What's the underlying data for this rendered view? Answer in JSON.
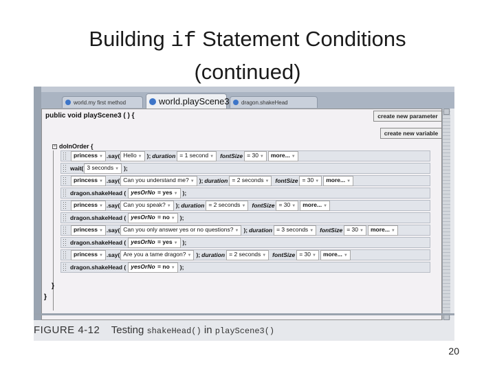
{
  "slide": {
    "title_pre": "Building ",
    "title_code": "if",
    "title_post": " Statement Conditions",
    "title_line2": "(continued)",
    "page_number": "20"
  },
  "tabs": [
    {
      "label": "world.my first method"
    },
    {
      "label": "world.playScene3"
    },
    {
      "label": "dragon.shakeHead"
    }
  ],
  "method": {
    "signature": "public void playScene3 ( ) {",
    "create_param_label": "create new parameter",
    "create_var_label": "create new variable",
    "do_in_order": "doInOrder {",
    "closing_inner": "}",
    "closing_outer": "}"
  },
  "rows": [
    {
      "obj": "princess",
      "call": ".say(",
      "arg": "Hello",
      "close": ");",
      "p1l": "duration",
      "p1v": "= 1 second",
      "p2l": "fontSize",
      "p2v": "= 30",
      "more": "more..."
    },
    {
      "wait": "wait(",
      "arg": "3 seconds",
      "close": ");"
    },
    {
      "obj": "princess",
      "call": ".say(",
      "arg": "Can you understand me?",
      "close": ");",
      "p1l": "duration",
      "p1v": "= 2 seconds",
      "p2l": "fontSize",
      "p2v": "= 30",
      "more": "more..."
    },
    {
      "obj": "dragon.shakeHead (",
      "arg_l": "yesOrNo",
      "arg_v": "= yes",
      "close": ");"
    },
    {
      "obj": "princess",
      "call": ".say(",
      "arg": "Can you speak?",
      "close": ");",
      "p1l": "duration",
      "p1v": "= 2 seconds",
      "p2l": "fontSize",
      "p2v": "= 30",
      "more": "more..."
    },
    {
      "obj": "dragon.shakeHead (",
      "arg_l": "yesOrNo",
      "arg_v": "= no",
      "close": ");"
    },
    {
      "obj": "princess",
      "call": ".say(",
      "arg": "Can you only answer yes or no questions?",
      "close": ");",
      "p1l": "duration",
      "p1v": "= 3 seconds",
      "p2l": "fontSize",
      "p2v": "= 30",
      "more": "more..."
    },
    {
      "obj": "dragon.shakeHead (",
      "arg_l": "yesOrNo",
      "arg_v": "= yes",
      "close": ");"
    },
    {
      "obj": "princess",
      "call": ".say(",
      "arg": "Are you a tame dragon?",
      "close": ");",
      "p1l": "duration",
      "p1v": "= 2 seconds",
      "p2l": "fontSize",
      "p2v": "= 30",
      "more": "more..."
    },
    {
      "obj": "dragon.shakeHead (",
      "arg_l": "yesOrNo",
      "arg_v": "= no",
      "close": ");"
    }
  ],
  "caption": {
    "figure": "FIGURE 4-12",
    "text1": "Testing",
    "code1": "shakeHead()",
    "text2": "in",
    "code2": "playScene3()"
  },
  "icons": {
    "tab_dot": "circle-icon",
    "dropdown": "triangle-down-icon",
    "collapse": "minus-box-icon"
  },
  "colors": {
    "tab_dot": "#3d75c8",
    "frame": "#aab4c2"
  }
}
